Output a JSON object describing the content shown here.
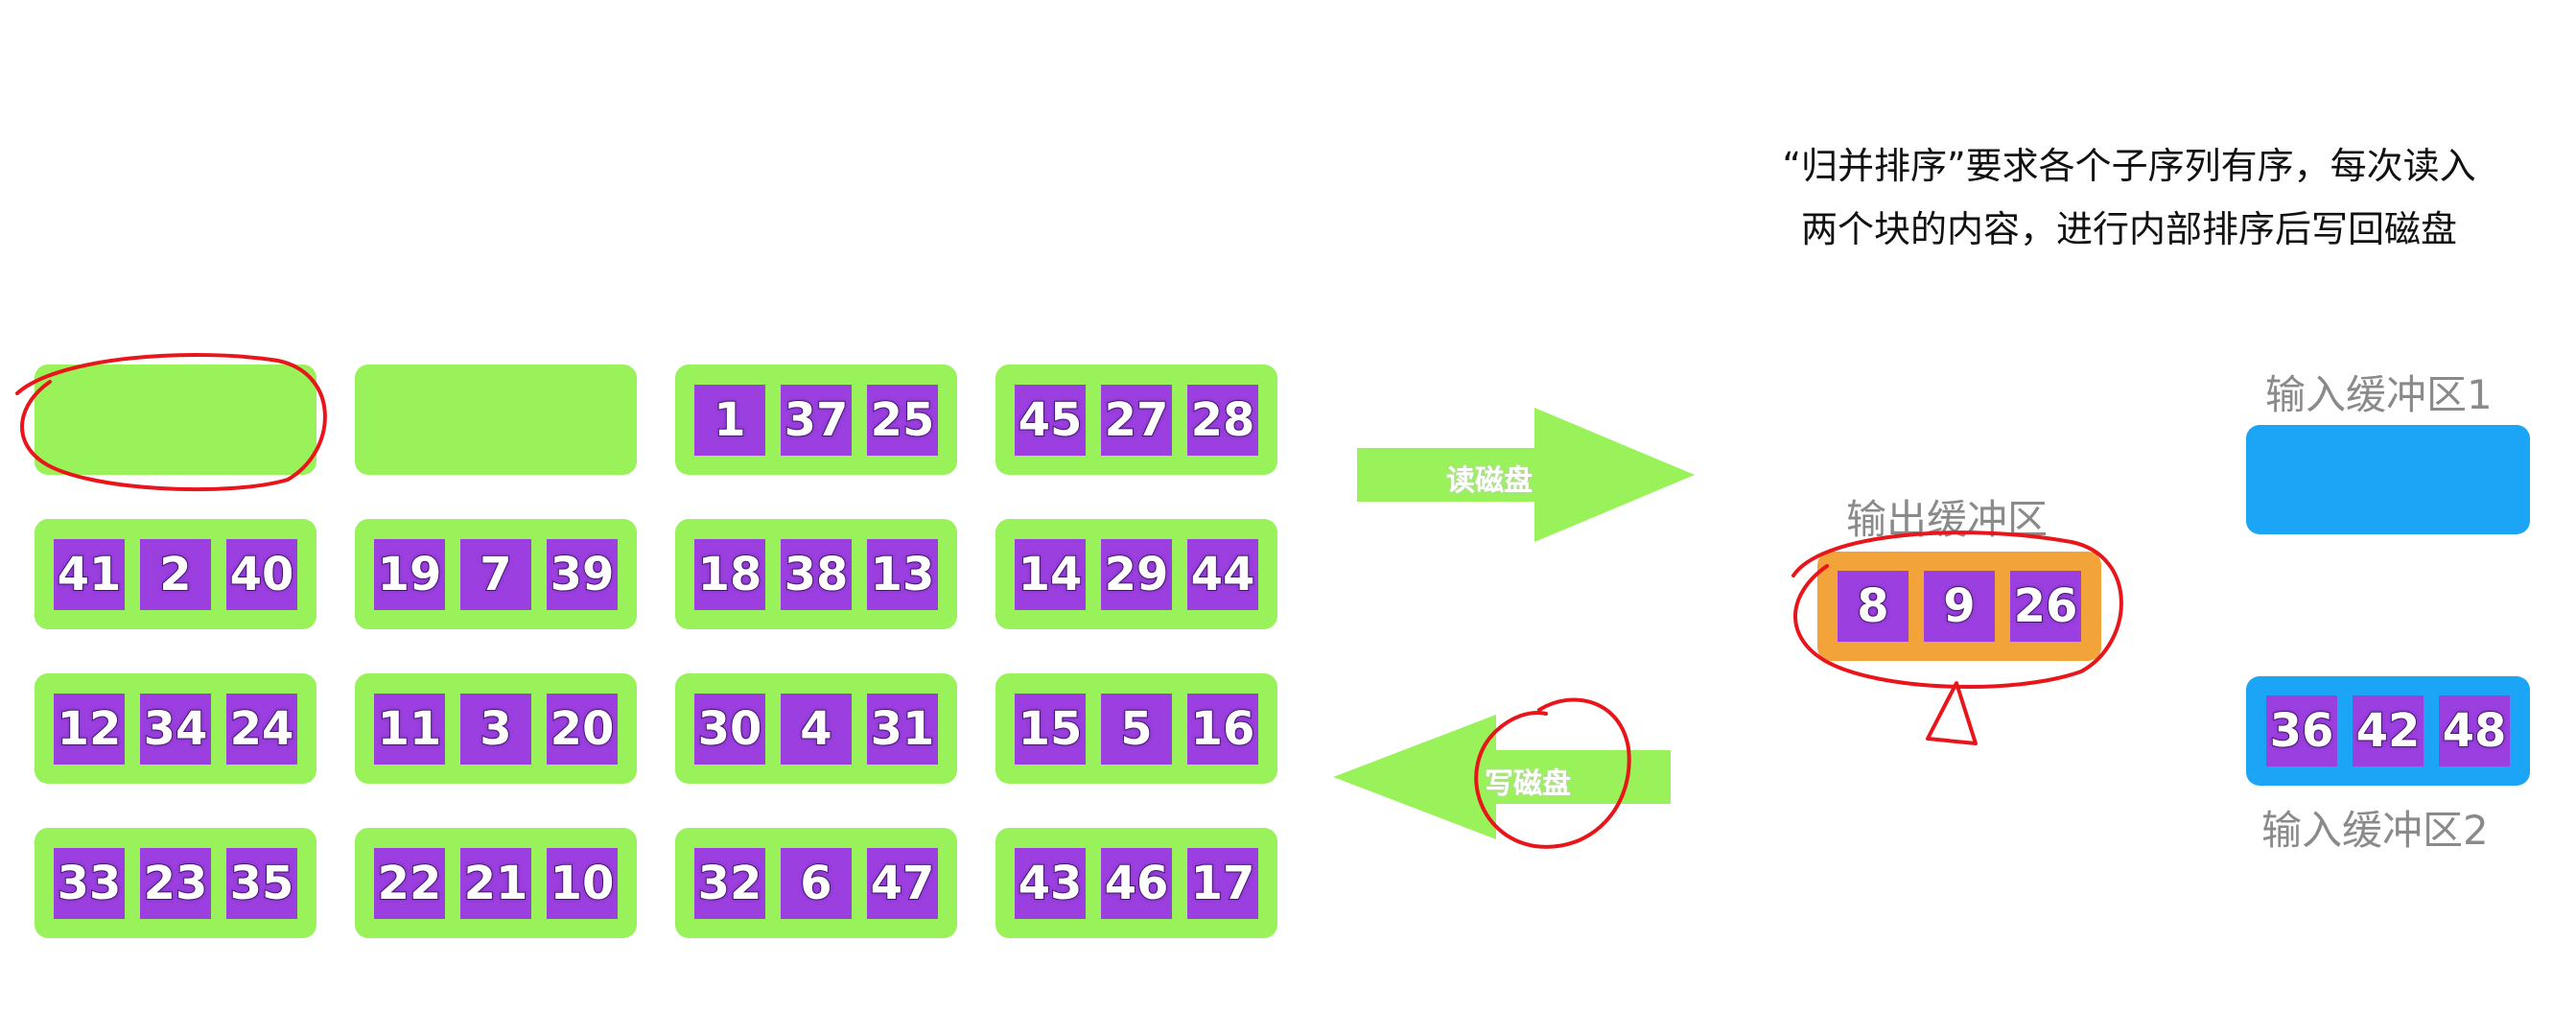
{
  "caption": {
    "line1": "“归并排序”要求各个子序列有序，每次读入",
    "line2": "两个块的内容，进行内部排序后写回磁盘"
  },
  "disk": {
    "blocks": [
      [],
      [],
      [
        "1",
        "37",
        "25"
      ],
      [
        "45",
        "27",
        "28"
      ],
      [
        "41",
        "2",
        "40"
      ],
      [
        "19",
        "7",
        "39"
      ],
      [
        "18",
        "38",
        "13"
      ],
      [
        "14",
        "29",
        "44"
      ],
      [
        "12",
        "34",
        "24"
      ],
      [
        "11",
        "3",
        "20"
      ],
      [
        "30",
        "4",
        "31"
      ],
      [
        "15",
        "5",
        "16"
      ],
      [
        "33",
        "23",
        "35"
      ],
      [
        "22",
        "21",
        "10"
      ],
      [
        "32",
        "6",
        "47"
      ],
      [
        "43",
        "46",
        "17"
      ]
    ]
  },
  "arrows": {
    "read_label": "读磁盘",
    "write_label": "写磁盘"
  },
  "output_buffer": {
    "label": "输出缓冲区",
    "values": [
      "8",
      "9",
      "26"
    ]
  },
  "input_buffer_1": {
    "label": "输入缓冲区1",
    "values": []
  },
  "input_buffer_2": {
    "label": "输入缓冲区2",
    "values": [
      "36",
      "42",
      "48"
    ]
  },
  "colors": {
    "disk_block": "#99f25a",
    "cell": "#9b3fe0",
    "arrow": "#99f25a",
    "output_buffer": "#f2a33a",
    "input_buffer": "#1ca4f6",
    "annotation": "#e8161b"
  }
}
